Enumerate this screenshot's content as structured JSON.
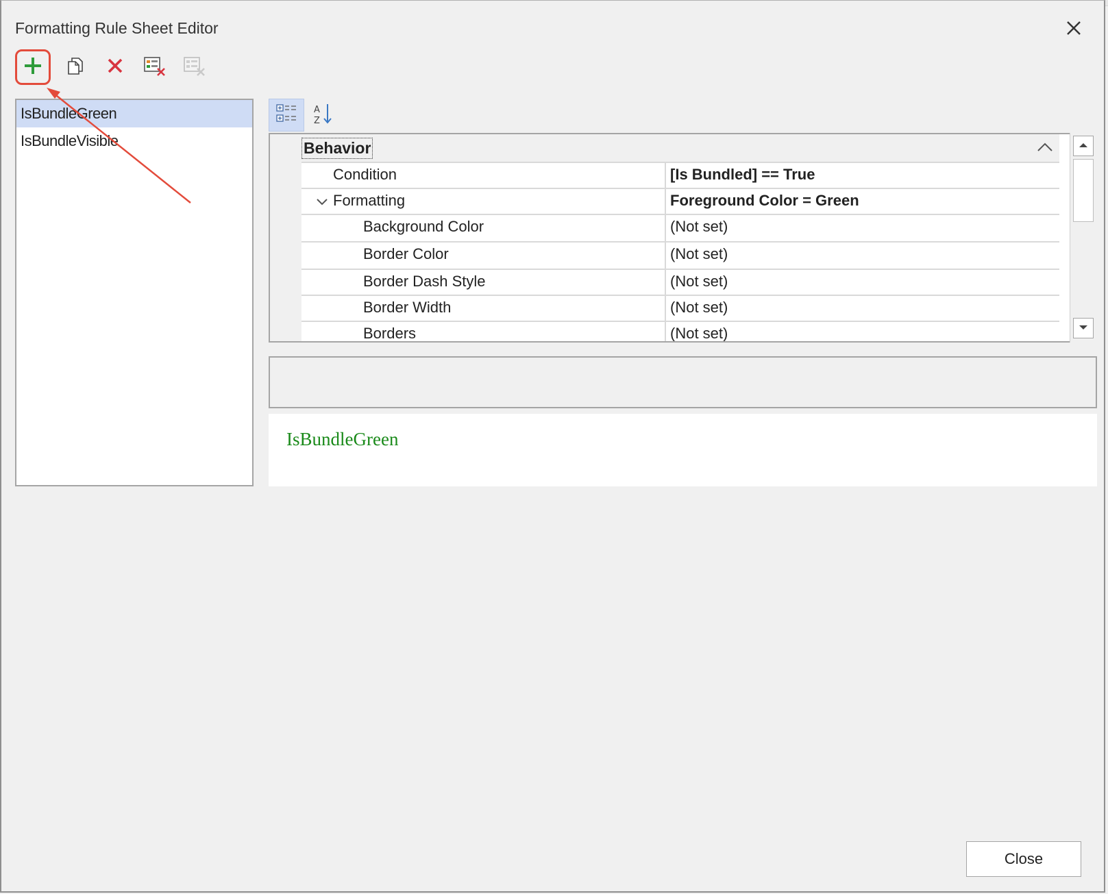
{
  "window": {
    "title": "Formatting Rule Sheet Editor"
  },
  "toolbar": {
    "add": "add-icon",
    "copy": "copy-icon",
    "delete": "delete-icon",
    "purge": "purge-rules-icon",
    "purge_disabled": "purge-all-icon"
  },
  "rules": {
    "items": [
      {
        "label": "IsBundleGreen",
        "selected": true
      },
      {
        "label": "IsBundleVisible",
        "selected": false
      }
    ]
  },
  "property_grid": {
    "category": "Behavior",
    "rows": [
      {
        "name": "Condition",
        "value": "[Is Bundled] == True"
      },
      {
        "name": "Formatting",
        "value": "Foreground Color = Green"
      },
      {
        "name": "Background Color",
        "value": "(Not set)"
      },
      {
        "name": "Border Color",
        "value": "(Not set)"
      },
      {
        "name": "Border Dash Style",
        "value": "(Not set)"
      },
      {
        "name": "Border Width",
        "value": "(Not set)"
      },
      {
        "name": "Borders",
        "value": "(Not set)"
      }
    ]
  },
  "preview": {
    "text": "IsBundleGreen",
    "color": "#1a8a1a"
  },
  "buttons": {
    "close_label": "Close"
  },
  "colors": {
    "highlight": "#e34b3b",
    "selection": "#cfdcf5",
    "add_green": "#2e9b3a",
    "delete_red": "#d8343f"
  }
}
